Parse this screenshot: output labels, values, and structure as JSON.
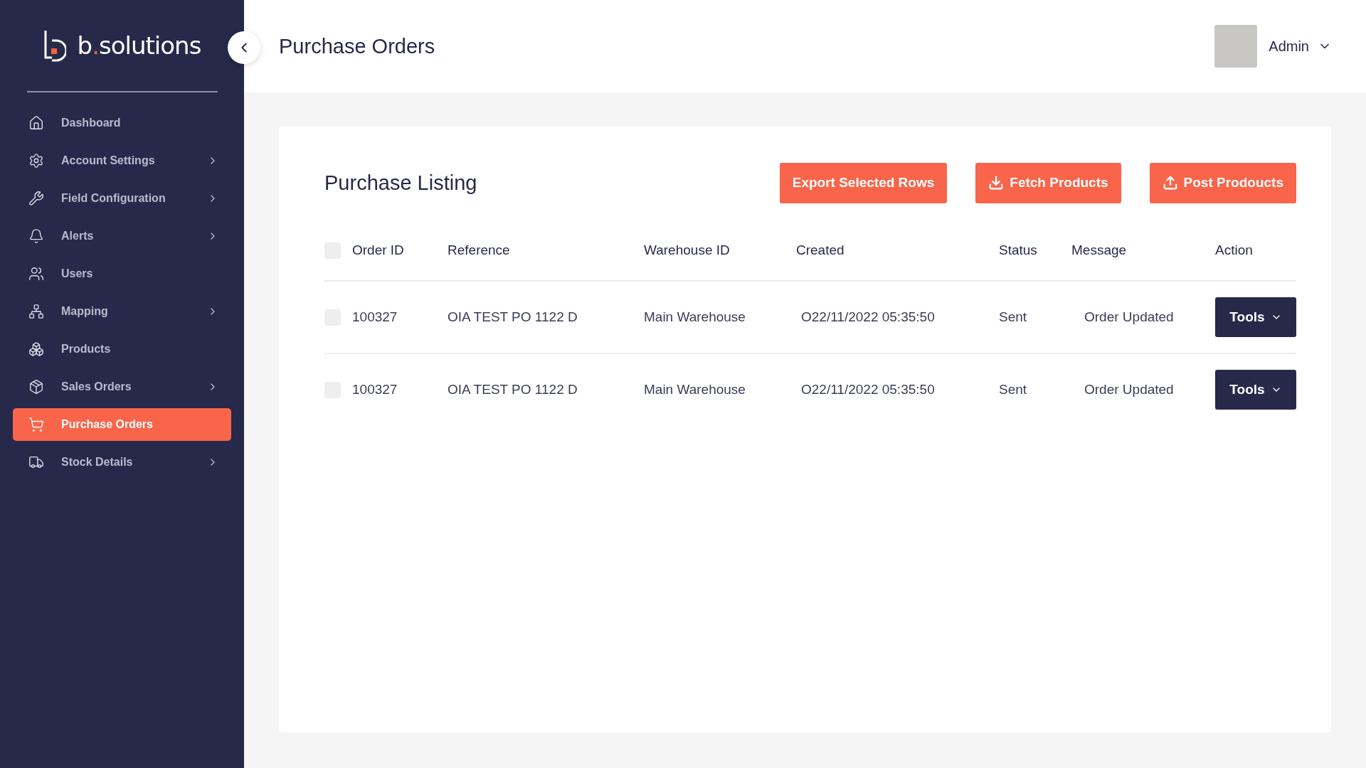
{
  "logo": {
    "prefix": "b",
    "accent": ".",
    "suffix": "solutions"
  },
  "sidebar": {
    "items": [
      {
        "label": "Dashboard",
        "kind": "home",
        "has_submenu": false,
        "selected": false
      },
      {
        "label": "Account Settings",
        "kind": "gears",
        "has_submenu": true,
        "selected": false
      },
      {
        "label": "Field Configuration",
        "kind": "wrench",
        "has_submenu": true,
        "selected": false
      },
      {
        "label": "Alerts",
        "kind": "bell",
        "has_submenu": true,
        "selected": false
      },
      {
        "label": "Users",
        "kind": "users",
        "has_submenu": false,
        "selected": false
      },
      {
        "label": "Mapping",
        "kind": "network",
        "has_submenu": true,
        "selected": false
      },
      {
        "label": "Products",
        "kind": "boxes",
        "has_submenu": false,
        "selected": false
      },
      {
        "label": "Sales Orders",
        "kind": "package",
        "has_submenu": true,
        "selected": false
      },
      {
        "label": "Purchase Orders",
        "kind": "cart",
        "has_submenu": false,
        "selected": true
      },
      {
        "label": "Stock Details",
        "kind": "dolly",
        "has_submenu": true,
        "selected": false
      }
    ]
  },
  "header": {
    "title": "Purchase Orders",
    "user": "Admin"
  },
  "card": {
    "title": "Purchase Listing",
    "buttons": [
      {
        "label": "Export Selected Rows",
        "kind": "plain"
      },
      {
        "label": "Fetch Products",
        "kind": "download"
      },
      {
        "label": "Post Prodoucts",
        "kind": "upload"
      }
    ],
    "table": {
      "select_all": {
        "checked": false
      },
      "columns": [
        "Order ID",
        "Reference",
        "Warehouse ID",
        "Created",
        "Status",
        "Message",
        "Action"
      ],
      "rows": [
        {
          "checked": false,
          "order_id": "100327",
          "reference": "OIA TEST PO 1122 D",
          "warehouse": "Main Warehouse",
          "created": "O22/11/2022 05:35:50",
          "status": "Sent",
          "message": "Order Updated",
          "action": "Tools"
        },
        {
          "checked": false,
          "order_id": "100327",
          "reference": "OIA TEST PO 1122 D",
          "warehouse": "Main Warehouse",
          "created": "O22/11/2022 05:35:50",
          "status": "Sent",
          "message": "Order Updated",
          "action": "Tools"
        }
      ]
    }
  }
}
